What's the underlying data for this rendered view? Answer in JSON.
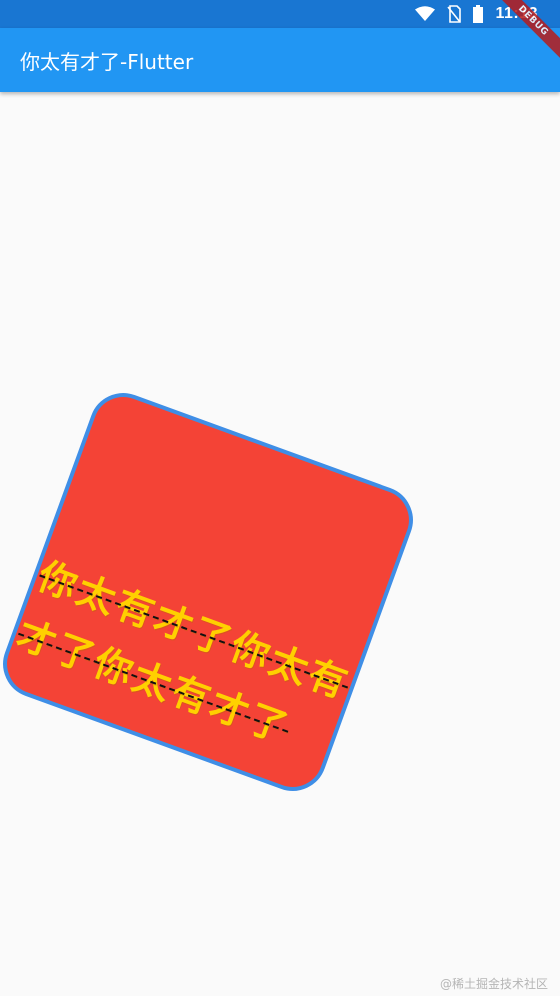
{
  "status_bar": {
    "time": "11:13",
    "icons": [
      "wifi-icon",
      "no-sim-icon",
      "battery-icon"
    ]
  },
  "app_bar": {
    "title": "你太有才了-Flutter"
  },
  "debug_banner": {
    "label": "DEBUG"
  },
  "content": {
    "text": "你太有才了你太有才了你太有才了"
  },
  "watermark": {
    "text": "@稀土掘金技术社区"
  },
  "colors": {
    "status_bar": "#1976d2",
    "app_bar": "#2196f3",
    "box_fill": "#f44336",
    "box_border": "#3f8ee6",
    "text": "#ffd000"
  }
}
